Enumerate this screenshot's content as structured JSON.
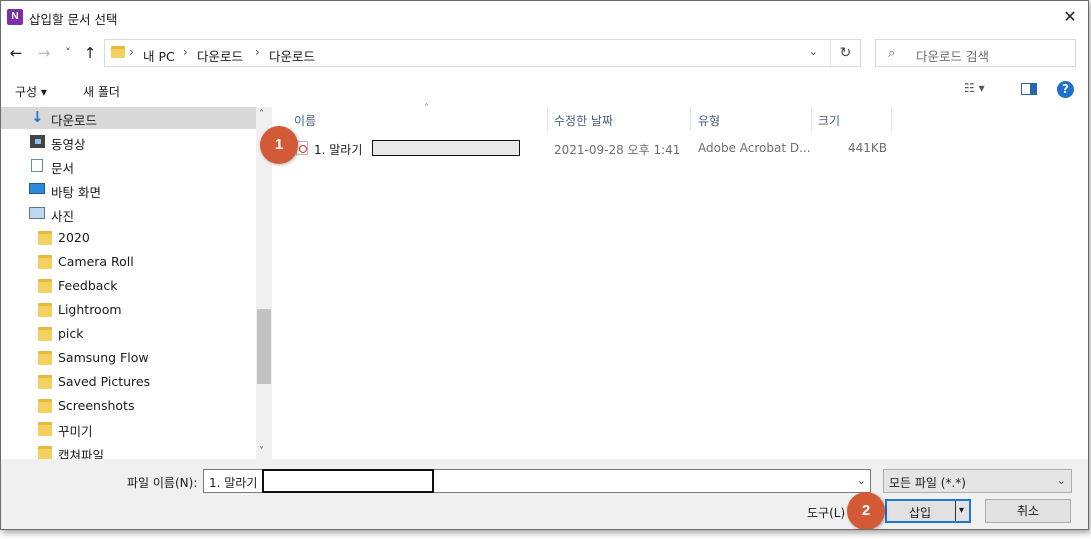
{
  "window": {
    "title": "삽입할 문서 선택",
    "app_icon_letter": "N",
    "close_glyph": "✕"
  },
  "nav": {
    "back_glyph": "←",
    "forward_glyph": "→",
    "recent_glyph": "˅",
    "up_glyph": "↑",
    "address": [
      "내 PC",
      "다운로드",
      "다운로드"
    ],
    "chevron": "›",
    "dropdown_glyph": "⌄",
    "refresh_glyph": "↻",
    "search_icon": "⌕",
    "search_placeholder": "다운로드 검색"
  },
  "commands": {
    "organize": "구성 ▾",
    "new_folder": "새 폴더",
    "view_glyph": "☷ ▾",
    "help_glyph": "?"
  },
  "sidebar": {
    "items": [
      {
        "label": "다운로드",
        "icon": "download-icon"
      },
      {
        "label": "동영상",
        "icon": "video-icon"
      },
      {
        "label": "문서",
        "icon": "document-icon"
      },
      {
        "label": "바탕 화면",
        "icon": "desktop-icon"
      },
      {
        "label": "사진",
        "icon": "pictures-icon"
      },
      {
        "label": "2020",
        "icon": "folder-icon"
      },
      {
        "label": "Camera Roll",
        "icon": "folder-icon"
      },
      {
        "label": "Feedback",
        "icon": "folder-icon"
      },
      {
        "label": "Lightroom",
        "icon": "folder-icon"
      },
      {
        "label": "pick",
        "icon": "folder-icon"
      },
      {
        "label": "Samsung Flow",
        "icon": "folder-icon"
      },
      {
        "label": "Saved Pictures",
        "icon": "folder-icon"
      },
      {
        "label": "Screenshots",
        "icon": "folder-icon"
      },
      {
        "label": "꾸미기",
        "icon": "folder-icon"
      },
      {
        "label": "캡쳐파일",
        "icon": "folder-icon"
      }
    ],
    "scroll_up": "˄",
    "scroll_down": "˅"
  },
  "filelist": {
    "columns": [
      "이름",
      "수정한 날짜",
      "유형",
      "크기"
    ],
    "sort_glyph": "˄",
    "rows": [
      {
        "name": "1. 말라기 ",
        "date": "2021-09-28 오후 1:41",
        "type": "Adobe Acrobat D...",
        "size": "441KB"
      }
    ]
  },
  "bottom": {
    "filename_label": "파일 이름(N):",
    "filename_value": "1. 말라기",
    "filetype_value": "모든 파일 (*.*)",
    "tools_label": "도구(L)",
    "insert_label": "삽입",
    "cancel_label": "취소",
    "dropdown_glyph": "⌄",
    "split_glyph": "▾"
  },
  "badges": {
    "one": "1",
    "two": "2"
  },
  "colors": {
    "accent": "#1e78d4",
    "badge": "#d35a36",
    "selection": "#cce8ff"
  }
}
